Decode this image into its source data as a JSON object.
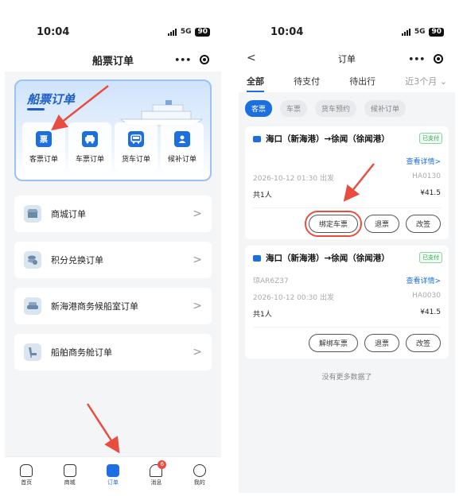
{
  "left": {
    "status": {
      "time": "10:04",
      "network": "5G",
      "battery": "90"
    },
    "nav_title": "船票订单",
    "capsule_dots": "•••",
    "banner": {
      "title": "船票订单",
      "icons": [
        {
          "label": "客票订单",
          "glyph": "票",
          "icon": "ticket-icon"
        },
        {
          "label": "车票订单",
          "glyph": "车",
          "icon": "car-icon"
        },
        {
          "label": "货车订单",
          "glyph": "货",
          "icon": "truck-icon"
        },
        {
          "label": "候补订单",
          "glyph": "候",
          "icon": "waitlist-icon"
        }
      ]
    },
    "menu": [
      {
        "label": "商城订单",
        "icon": "shop-icon"
      },
      {
        "label": "积分兑换订单",
        "icon": "coins-icon"
      },
      {
        "label": "新海港商务候船室订单",
        "icon": "sofa-icon"
      },
      {
        "label": "船舶商务舱订单",
        "icon": "seat-icon"
      }
    ],
    "tabbar": [
      {
        "label": "首页",
        "icon": "home-icon",
        "active": false
      },
      {
        "label": "商城",
        "icon": "store-icon",
        "active": false
      },
      {
        "label": "订单",
        "icon": "order-icon",
        "active": true
      },
      {
        "label": "消息",
        "icon": "bell-icon",
        "active": false,
        "badge": "6"
      },
      {
        "label": "我的",
        "icon": "profile-icon",
        "active": false
      }
    ]
  },
  "right": {
    "status": {
      "time": "10:04",
      "network": "5G",
      "battery": "90"
    },
    "back": "<",
    "nav_title": "订单",
    "tabs": [
      "全部",
      "待支付",
      "待出行",
      "近3个月"
    ],
    "chips": [
      "客票",
      "车票",
      "货车预约",
      "候补订单"
    ],
    "orders": [
      {
        "route": "海口（新海港）→徐闻（徐闻港）",
        "status": "已支付",
        "code": "",
        "detail_link": "查看详情>",
        "datetime": "2026-10-12 01:30 出发",
        "ship_no": "HA0130",
        "persons": "共1人",
        "price": "¥41.5",
        "buttons": [
          "绑定车票",
          "退票",
          "改签"
        ]
      },
      {
        "route": "海口（新海港）→徐闻（徐闻港）",
        "status": "已支付",
        "code": "琼AR6Z37",
        "detail_link": "查看详情>",
        "datetime": "2026-10-12 00:30 出发",
        "ship_no": "HA0030",
        "persons": "共1人",
        "price": "¥41.5",
        "buttons": [
          "解绑车票",
          "退票",
          "改签"
        ]
      }
    ],
    "no_more": "没有更多数据了"
  },
  "colors": {
    "accent": "#1d6fe0",
    "highlight": "#e94d3f",
    "paid": "#2daa4a"
  }
}
